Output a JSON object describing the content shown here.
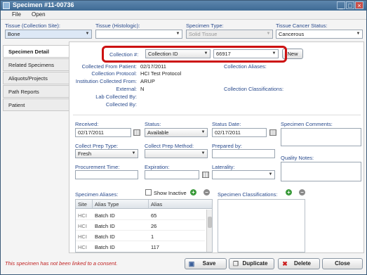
{
  "window": {
    "title": "Specimen #11-00736"
  },
  "menu": [
    "File",
    "Open"
  ],
  "top_fields": {
    "tissue_site": {
      "label": "Tissue (Collection Site):",
      "value": "Bone"
    },
    "tissue_histologic": {
      "label": "Tissue (Histologic):",
      "value": ""
    },
    "specimen_type": {
      "label": "Specimen Type:",
      "value": "Solid Tissue"
    },
    "tissue_cancer_status": {
      "label": "Tissue Cancer Status:",
      "value": "Cancerous"
    }
  },
  "side_tabs": [
    "Specimen Detail",
    "Related Specimens",
    "Aliquots/Projects",
    "Path Reports",
    "Patient"
  ],
  "collection": {
    "label": "Collection #:",
    "type_value": "Collection ID",
    "number_value": "66917",
    "new_label": "New"
  },
  "details": {
    "collected_from_patient": {
      "label": "Collected From Patient:",
      "value": "02/17/2011"
    },
    "collection_protocol": {
      "label": "Collection Protocol:",
      "value": "HCI Test Protocol"
    },
    "institution": {
      "label": "Institution Collected From:",
      "value": "ARUP"
    },
    "external": {
      "label": "External:",
      "value": "N"
    },
    "lab_collected_by": {
      "label": "Lab Collected By:",
      "value": ""
    },
    "collected_by": {
      "label": "Collected By:",
      "value": ""
    },
    "collection_aliases_label": "Collection Aliases:",
    "collection_classifications_label": "Collection Classifications:"
  },
  "form": {
    "received": {
      "label": "Received:",
      "value": "02/17/2011"
    },
    "status": {
      "label": "Status:",
      "value": "Available"
    },
    "status_date": {
      "label": "Status Date:",
      "value": "02/17/2011"
    },
    "specimen_comments": {
      "label": "Specimen Comments:"
    },
    "collect_prep_type": {
      "label": "Collect Prep Type:",
      "value": "Fresh"
    },
    "collect_prep_method": {
      "label": "Collect Prep Method:",
      "value": ""
    },
    "prepared_by": {
      "label": "Prepared by:",
      "value": ""
    },
    "quality_notes": {
      "label": "Quality Notes:"
    },
    "procurement_time": {
      "label": "Procurement Time:",
      "value": ""
    },
    "expiration": {
      "label": "Expiration:",
      "value": ""
    },
    "laterality": {
      "label": "Laterality:",
      "value": ""
    }
  },
  "aliases": {
    "label": "Specimen Aliases:",
    "show_inactive": "Show Inactive",
    "columns": [
      "Site",
      "Alias Type",
      "Alias"
    ],
    "rows": [
      {
        "site": "HCI",
        "type": "Batch ID",
        "alias": "65"
      },
      {
        "site": "HCI",
        "type": "Batch ID",
        "alias": "26"
      },
      {
        "site": "HCI",
        "type": "Batch ID",
        "alias": "1"
      },
      {
        "site": "HCI",
        "type": "Batch ID",
        "alias": "117"
      }
    ]
  },
  "classifications": {
    "label": "Specimen Classifications:"
  },
  "footer": {
    "message": "This specimen has not been linked to a consent.",
    "save": "Save",
    "duplicate": "Duplicate",
    "delete": "Delete",
    "close": "Close"
  }
}
